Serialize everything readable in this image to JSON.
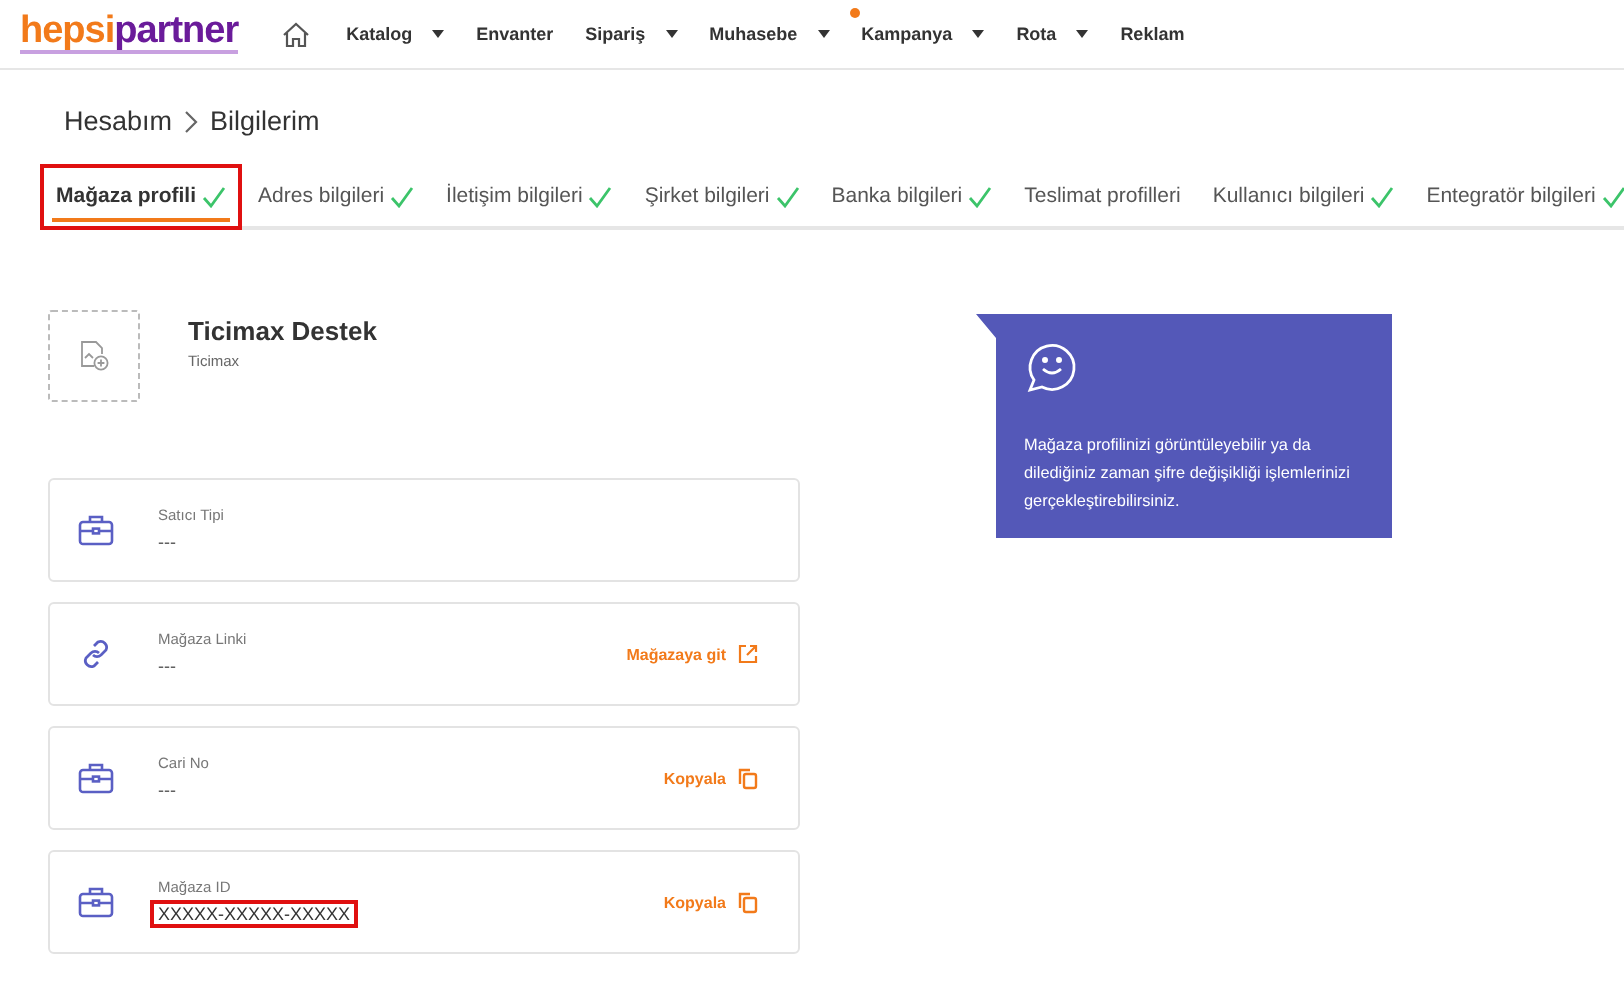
{
  "logo": {
    "first": "hepsi",
    "second": "partner"
  },
  "nav": [
    {
      "label": "Katalog",
      "dropdown": true,
      "notification": false
    },
    {
      "label": "Envanter",
      "dropdown": false,
      "notification": false
    },
    {
      "label": "Sipariş",
      "dropdown": true,
      "notification": false
    },
    {
      "label": "Muhasebe",
      "dropdown": true,
      "notification": false
    },
    {
      "label": "Kampanya",
      "dropdown": true,
      "notification": true
    },
    {
      "label": "Rota",
      "dropdown": true,
      "notification": false
    },
    {
      "label": "Reklam",
      "dropdown": false,
      "notification": false
    }
  ],
  "breadcrumb": [
    "Hesabım",
    "Bilgilerim"
  ],
  "tabs": [
    {
      "label": "Mağaza profili",
      "selected": true,
      "complete": true,
      "highlighted": true
    },
    {
      "label": "Adres bilgileri",
      "selected": false,
      "complete": true,
      "highlighted": false
    },
    {
      "label": "İletişim bilgileri",
      "selected": false,
      "complete": true,
      "highlighted": false
    },
    {
      "label": "Şirket bilgileri",
      "selected": false,
      "complete": true,
      "highlighted": false
    },
    {
      "label": "Banka bilgileri",
      "selected": false,
      "complete": true,
      "highlighted": false
    },
    {
      "label": "Teslimat profilleri",
      "selected": false,
      "complete": false,
      "highlighted": false
    },
    {
      "label": "Kullanıcı bilgileri",
      "selected": false,
      "complete": true,
      "highlighted": false
    },
    {
      "label": "Entegratör bilgileri",
      "selected": false,
      "complete": true,
      "highlighted": false
    }
  ],
  "profile": {
    "name": "Ticimax Destek",
    "subtitle": "Ticimax"
  },
  "fields": [
    {
      "label": "Satıcı Tipi",
      "value": "---",
      "highlighted": false
    },
    {
      "label": "Mağaza Linki",
      "value": "---",
      "highlighted": false,
      "action": {
        "kind": "external",
        "label": "Mağazaya git"
      }
    },
    {
      "label": "Cari No",
      "value": "---",
      "highlighted": false,
      "action": {
        "kind": "copy",
        "label": "Kopyala"
      }
    },
    {
      "label": "Mağaza ID",
      "value": "XXXXX-XXXXX-XXXXX",
      "highlighted": true,
      "action": {
        "kind": "copy",
        "label": "Kopyala"
      }
    }
  ],
  "info": {
    "text": "Mağaza profilinizi görüntüleyebilir ya da dilediğiniz zaman şifre değişikliği işlemlerinizi gerçekleştirebilirsiniz."
  }
}
